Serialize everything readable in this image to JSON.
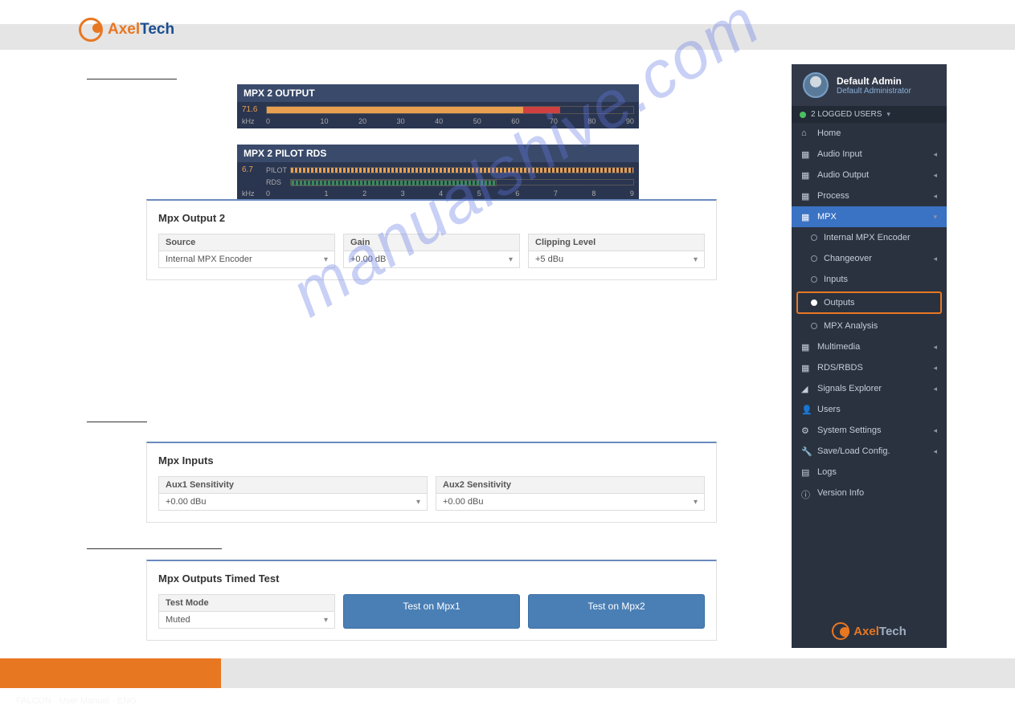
{
  "logo": {
    "brand1": "Axel",
    "brand2": "Tech"
  },
  "meters": {
    "m1": {
      "title": "MPX 2 OUTPUT",
      "value": "71.6",
      "unit": "kHz",
      "ticks": [
        "0",
        "10",
        "20",
        "30",
        "40",
        "50",
        "60",
        "70",
        "80",
        "90"
      ]
    },
    "m2": {
      "title": "MPX 2 PILOT RDS",
      "value": "6.7",
      "l1": "PILOT",
      "l2": "RDS",
      "unit": "kHz",
      "ticks": [
        "0",
        "1",
        "2",
        "3",
        "4",
        "5",
        "6",
        "7",
        "8",
        "9"
      ]
    }
  },
  "panel2": {
    "title": "Mpx Output 2",
    "source": {
      "label": "Source",
      "value": "Internal MPX Encoder"
    },
    "gain": {
      "label": "Gain",
      "value": "+0.00 dB"
    },
    "clip": {
      "label": "Clipping Level",
      "value": "+5 dBu"
    }
  },
  "panel3": {
    "title": "Mpx Inputs",
    "aux1": {
      "label": "Aux1 Sensitivity",
      "value": "+0.00 dBu"
    },
    "aux2": {
      "label": "Aux2 Sensitivity",
      "value": "+0.00 dBu"
    }
  },
  "panel4": {
    "title": "Mpx Outputs Timed Test",
    "mode": {
      "label": "Test Mode",
      "value": "Muted"
    },
    "btn1": "Test on Mpx1",
    "btn2": "Test on Mpx2"
  },
  "sidebar": {
    "user": {
      "name": "Default Admin",
      "role": "Default Administrator"
    },
    "logged": "2 LOGGED USERS",
    "items": {
      "home": "Home",
      "ain": "Audio Input",
      "aout": "Audio Output",
      "proc": "Process",
      "mpx": "MPX",
      "sub_enc": "Internal MPX Encoder",
      "sub_change": "Changeover",
      "sub_in": "Inputs",
      "sub_out": "Outputs",
      "sub_ana": "MPX Analysis",
      "multi": "Multimedia",
      "rds": "RDS/RBDS",
      "sig": "Signals Explorer",
      "users": "Users",
      "sys": "System Settings",
      "save": "Save/Load Config.",
      "logs": "Logs",
      "ver": "Version Info"
    }
  },
  "watermark": "manualshive.com",
  "footer": "FALCON · User Manual · ENG"
}
